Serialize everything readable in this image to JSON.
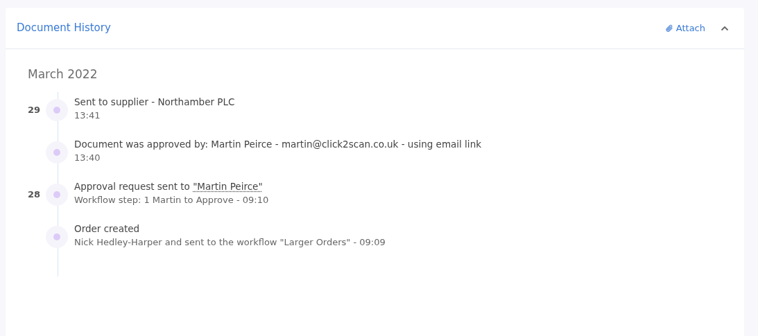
{
  "card": {
    "title": "Document History",
    "attach_label": "Attach",
    "expanded": true
  },
  "month": "March 2022",
  "events": [
    {
      "day": "29",
      "title": "Sent to supplier - Northamber PLC",
      "detail": "13:41"
    },
    {
      "title": "Document was approved by: Martin Peirce - martin@click2scan.co.uk - using email link",
      "detail": "13:40"
    },
    {
      "day": "28",
      "title": "Approval request sent to ",
      "title_tooltip": "\"Martin Peirce\"",
      "detail": "Workflow step: 1 Martin to Approve - 09:10"
    },
    {
      "title": "Order created",
      "detail": "Nick Hedley-Harper and sent to the workflow \"Larger Orders\" - 09:09"
    }
  ]
}
